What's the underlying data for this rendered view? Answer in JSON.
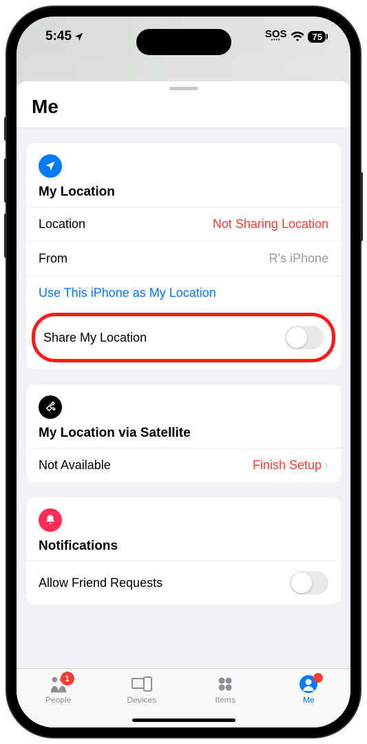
{
  "status": {
    "time": "5:45",
    "sos": "SOS",
    "battery": "75"
  },
  "sheet": {
    "title": "Me"
  },
  "location_card": {
    "title": "My Location",
    "location_label": "Location",
    "location_value": "Not Sharing Location",
    "from_label": "From",
    "from_value": "R's iPhone",
    "use_this_link": "Use This iPhone as My Location",
    "share_label": "Share My Location"
  },
  "satellite_card": {
    "title": "My Location via Satellite",
    "status_label": "Not Available",
    "action_label": "Finish Setup"
  },
  "notifications_card": {
    "title": "Notifications",
    "allow_label": "Allow Friend Requests"
  },
  "tabs": {
    "people": "People",
    "people_badge": "1",
    "devices": "Devices",
    "items": "Items",
    "me": "Me"
  }
}
